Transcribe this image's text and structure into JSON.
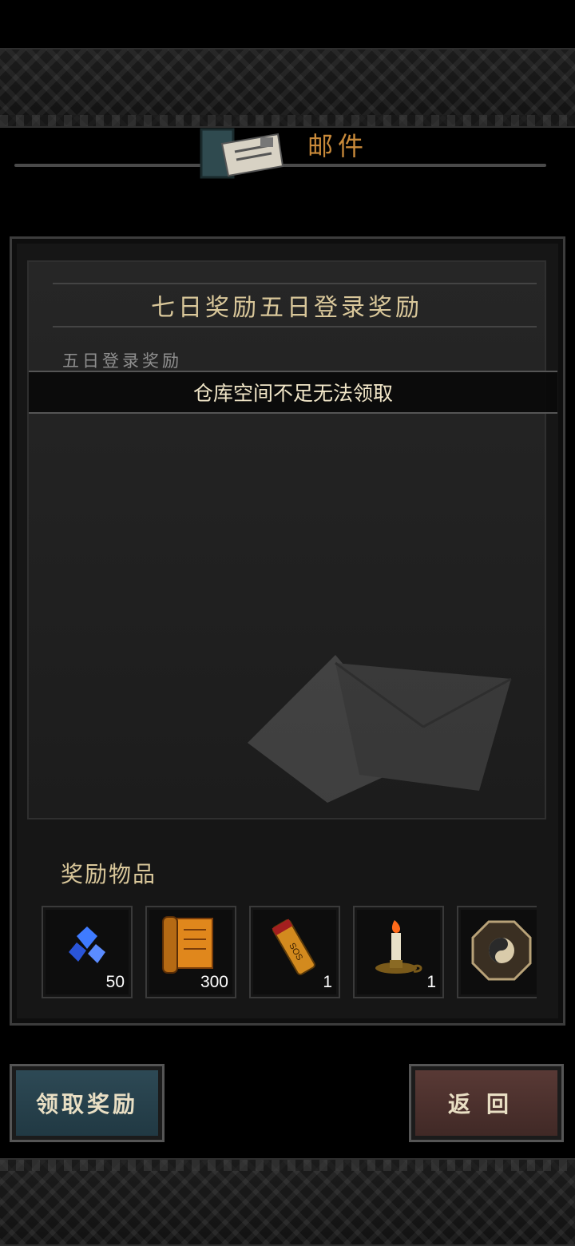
{
  "header": {
    "title": "邮件"
  },
  "mail": {
    "title": "七日奖励五日登录奖励",
    "subtitle": "五日登录奖励",
    "toast": "仓库空间不足无法领取"
  },
  "rewards": {
    "label": "奖励物品",
    "items": [
      {
        "icon": "blue-gems-icon",
        "quantity": "50"
      },
      {
        "icon": "scroll-icon",
        "quantity": "300"
      },
      {
        "icon": "sos-tube-icon",
        "quantity": "1"
      },
      {
        "icon": "candle-icon",
        "quantity": "1"
      },
      {
        "icon": "bagua-icon",
        "quantity": ""
      }
    ]
  },
  "buttons": {
    "claim": "领取奖励",
    "back": "返回"
  }
}
